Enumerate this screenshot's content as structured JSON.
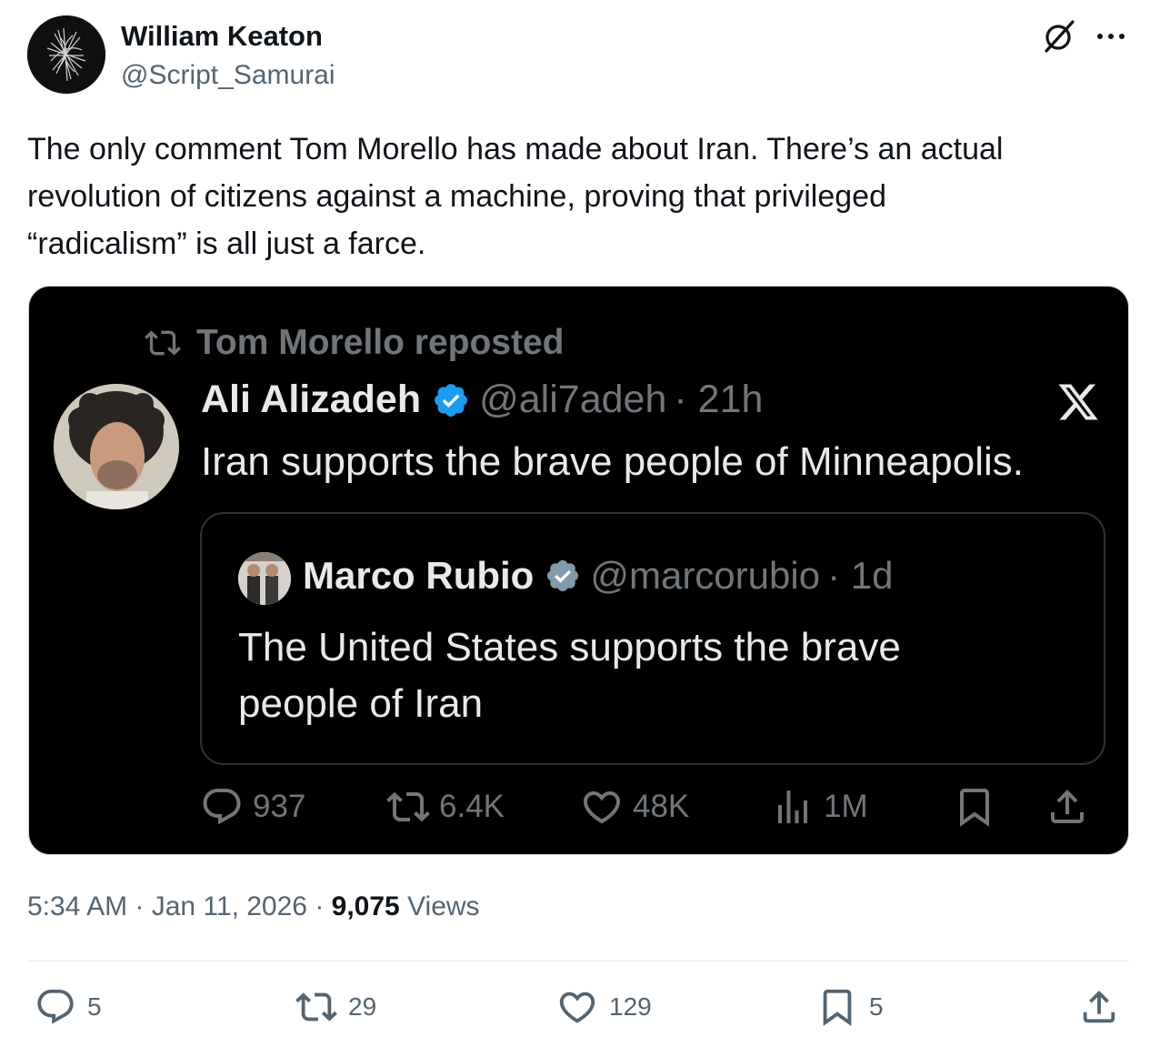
{
  "author": {
    "name": "William Keaton",
    "handle": "@Script_Samurai"
  },
  "post": {
    "text_lines": [
      "The only comment Tom Morello has made about Iran. There’s an actual",
      "revolution of citizens against a machine, proving that privileged",
      "“radicalism” is all just a farce."
    ]
  },
  "embedded": {
    "repost_label": "Tom Morello reposted",
    "tweet": {
      "name": "Ali Alizadeh",
      "handle": "@ali7adeh",
      "time": "· 21h",
      "text": "Iran supports the brave people of Minneapolis."
    },
    "quote": {
      "name": "Marco Rubio",
      "handle": "@marcorubio",
      "time": "· 1d",
      "text_lines": [
        "The United States supports the brave",
        "people of Iran"
      ]
    },
    "stats": {
      "replies": "937",
      "reposts": "6.4K",
      "likes": "48K",
      "views": "1M"
    }
  },
  "meta": {
    "time": "5:34 AM · Jan 11, 2026 ·",
    "views_count": "9,075",
    "views_label": "Views"
  },
  "actions": {
    "replies": "5",
    "reposts": "29",
    "likes": "129",
    "bookmarks": "5"
  },
  "colors": {
    "verified_blue": "#1d9bf0",
    "embed_bg": "#000000",
    "secondary_text": "#536471"
  }
}
